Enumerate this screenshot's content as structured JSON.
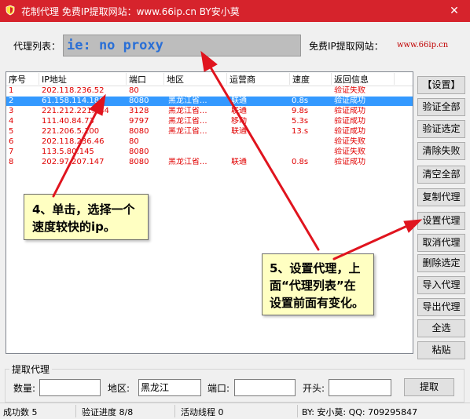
{
  "window": {
    "title": "花制代理 免费IP提取网站：www.66ip.cn    BY安小莫",
    "close_glyph": "✕"
  },
  "proxy_list": {
    "label": "代理列表：",
    "value": "ie: no proxy"
  },
  "free_site": {
    "label": "免费IP提取网站：",
    "url": "www.66ip.cn"
  },
  "table": {
    "columns": [
      "序号",
      "IP地址",
      "端口",
      "地区",
      "运营商",
      "速度",
      "返回信息"
    ],
    "rows": [
      {
        "no": "1",
        "ip": "202.118.236.52",
        "port": "80",
        "region": "",
        "isp": "",
        "speed": "",
        "result": "验证失败",
        "selected": false
      },
      {
        "no": "2",
        "ip": "61.158.114.188",
        "port": "8080",
        "region": "黑龙江省...",
        "isp": "联通",
        "speed": "0.8s",
        "result": "验证成功",
        "selected": true
      },
      {
        "no": "3",
        "ip": "221.212.221.184",
        "port": "3128",
        "region": "黑龙江省...",
        "isp": "联通",
        "speed": "9.8s",
        "result": "验证成功",
        "selected": false
      },
      {
        "no": "4",
        "ip": "111.40.84.73",
        "port": "9797",
        "region": "黑龙江省...",
        "isp": "移动",
        "speed": "5.3s",
        "result": "验证成功",
        "selected": false
      },
      {
        "no": "5",
        "ip": "221.206.5.100",
        "port": "8080",
        "region": "黑龙江省...",
        "isp": "联通",
        "speed": "13.s",
        "result": "验证成功",
        "selected": false
      },
      {
        "no": "6",
        "ip": "202.118.236.46",
        "port": "80",
        "region": "",
        "isp": "",
        "speed": "",
        "result": "验证失败",
        "selected": false
      },
      {
        "no": "7",
        "ip": "113.5.80.145",
        "port": "8080",
        "region": "",
        "isp": "",
        "speed": "",
        "result": "验证失败",
        "selected": false
      },
      {
        "no": "8",
        "ip": "202.97.207.147",
        "port": "8080",
        "region": "黑龙江省...",
        "isp": "联通",
        "speed": "0.8s",
        "result": "验证成功",
        "selected": false
      }
    ]
  },
  "buttons": [
    "【设置】",
    "验证全部",
    "验证选定",
    "清除失败",
    "清空全部",
    "复制代理",
    "设置代理",
    "取消代理",
    "删除选定",
    "导入代理",
    "导出代理",
    "全选",
    "粘贴"
  ],
  "fetch_group": {
    "title": "提取代理",
    "count_label": "数量:",
    "count_value": "",
    "region_label": "地区:",
    "region_value": "黑龙江",
    "port_label": "端口:",
    "port_value": "",
    "prefix_label": "开头:",
    "prefix_value": "",
    "fetch_button": "提取"
  },
  "status": {
    "success": "成功数 5",
    "progress": "验证进度 8/8",
    "threads": "活动线程 0",
    "author": "BY: 安小莫: QQ: 709295847"
  },
  "annotations": {
    "note4": "4、单击，选择一个速度较快的ip。",
    "note5": "5、设置代理，上面“代理列表”在设置前面有变化。"
  },
  "colors": {
    "titlebar": "#d6232c",
    "proxy_text": "#2a6fd6",
    "row_text": "#e00000",
    "selection": "#3399ff",
    "arrow": "#e0141e",
    "callout_bg": "#ffffc2"
  }
}
